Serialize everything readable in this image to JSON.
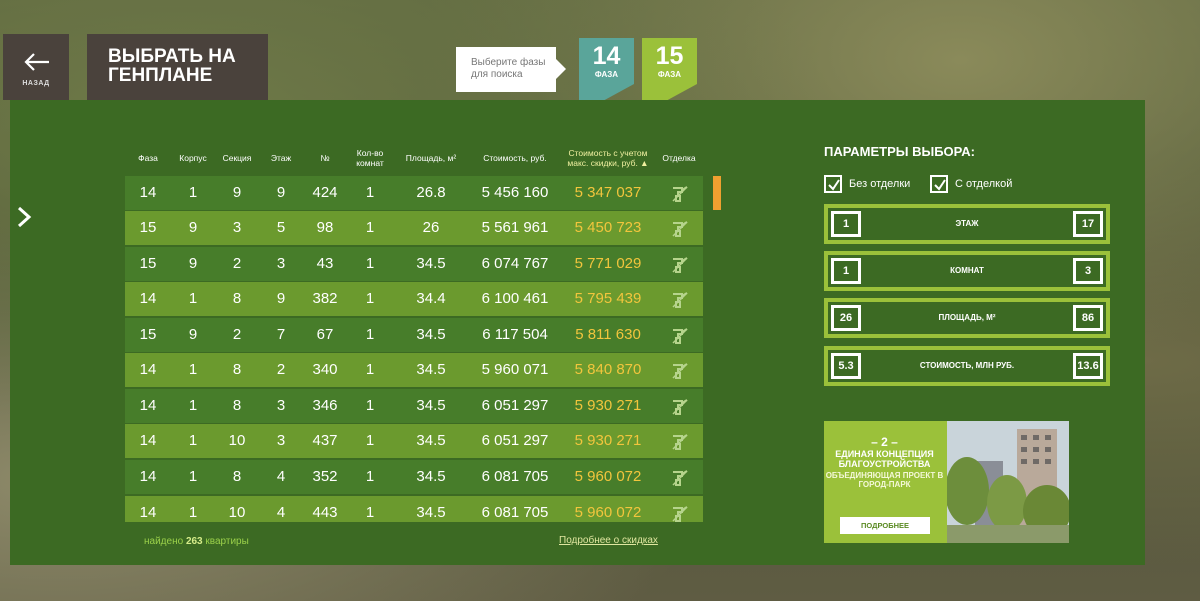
{
  "nav": {
    "back_label": "НАЗАД",
    "genplan_label": "ВЫБРАТЬ НА\nГЕНПЛАНЕ"
  },
  "phases": {
    "hint": "Выберите фазы для поиска",
    "items": [
      {
        "number": "14",
        "label": "ФАЗА",
        "color": "#5aa59a"
      },
      {
        "number": "15",
        "label": "ФАЗА",
        "color": "#9bc13a"
      }
    ]
  },
  "table": {
    "headers": [
      "Фаза",
      "Корпус",
      "Секция",
      "Этаж",
      "№",
      "Кол-во комнат",
      "Площадь, м²",
      "Стоимость, руб.",
      "Стоимость с учетом макс. скидки, руб. ▲",
      "Отделка"
    ],
    "rows": [
      [
        "14",
        "1",
        "9",
        "9",
        "424",
        "1",
        "26.8",
        "5 456 160",
        "5 347 037"
      ],
      [
        "15",
        "9",
        "3",
        "5",
        "98",
        "1",
        "26",
        "5 561 961",
        "5 450 723"
      ],
      [
        "15",
        "9",
        "2",
        "3",
        "43",
        "1",
        "34.5",
        "6 074 767",
        "5 771 029"
      ],
      [
        "14",
        "1",
        "8",
        "9",
        "382",
        "1",
        "34.4",
        "6 100 461",
        "5 795 439"
      ],
      [
        "15",
        "9",
        "2",
        "7",
        "67",
        "1",
        "34.5",
        "6 117 504",
        "5 811 630"
      ],
      [
        "14",
        "1",
        "8",
        "2",
        "340",
        "1",
        "34.5",
        "5 960 071",
        "5 840 870"
      ],
      [
        "14",
        "1",
        "8",
        "3",
        "346",
        "1",
        "34.5",
        "6 051 297",
        "5 930 271"
      ],
      [
        "14",
        "1",
        "10",
        "3",
        "437",
        "1",
        "34.5",
        "6 051 297",
        "5 930 271"
      ],
      [
        "14",
        "1",
        "8",
        "4",
        "352",
        "1",
        "34.5",
        "6 081 705",
        "5 960 072"
      ],
      [
        "14",
        "1",
        "10",
        "4",
        "443",
        "1",
        "34.5",
        "6 081 705",
        "5 960 072"
      ]
    ],
    "decor_icon": "roller-brush-icon",
    "found_prefix": "найдено",
    "found_count": "263",
    "found_suffix": "квартиры",
    "discount_link": "Подробнее о скидках"
  },
  "params": {
    "title": "ПАРАМЕТРЫ ВЫБОРА:",
    "checkboxes": [
      {
        "label": "Без отделки",
        "checked": true
      },
      {
        "label": "С отделкой",
        "checked": true
      }
    ],
    "ranges": [
      {
        "min": "1",
        "label": "ЭТАЖ",
        "max": "17"
      },
      {
        "min": "1",
        "label": "КОМНАТ",
        "max": "3"
      },
      {
        "min": "26",
        "label": "ПЛОЩАДЬ, М²",
        "max": "86"
      },
      {
        "min": "5.3",
        "label": "СТОИМОСТЬ, МЛН РУБ.",
        "max": "13.6"
      }
    ]
  },
  "promo": {
    "number": "– 2 –",
    "heading": "ЕДИНАЯ КОНЦЕПЦИЯ БЛАГОУСТРОЙСТВА",
    "subheading": "ОБЪЕДИНЯЮЩАЯ ПРОЕКТ В ГОРОД-ПАРК",
    "button": "ПОДРОБНЕЕ"
  },
  "colors": {
    "panel": "#3c6a23",
    "row_dark": "#477d2a",
    "row_light": "#6b9a2e",
    "discount_price": "#f2c53d",
    "scroll_thumb": "#f0a030"
  }
}
